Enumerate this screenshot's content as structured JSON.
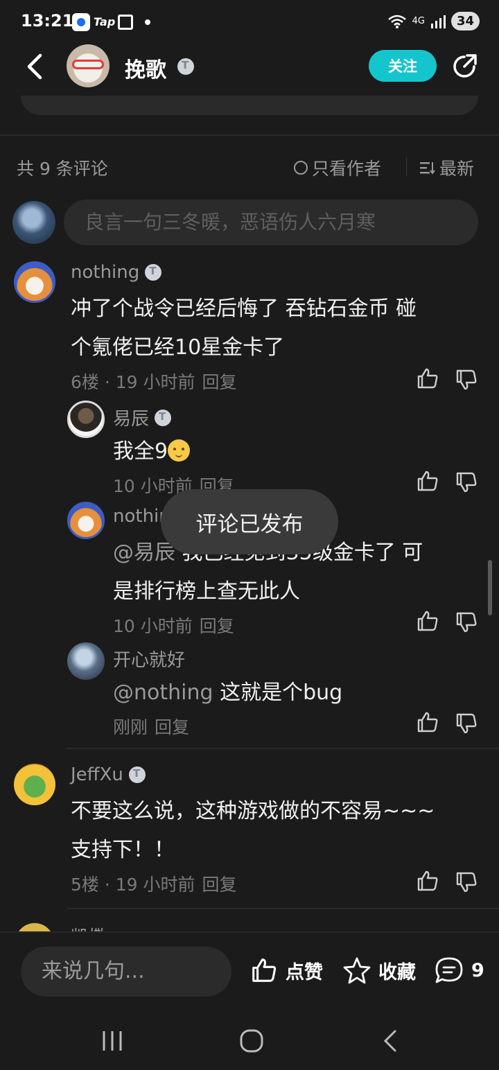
{
  "status_bar": {
    "time": "13:21",
    "app_label": "Tap",
    "network": "4G",
    "battery": "34"
  },
  "header": {
    "author_name": "挽歌",
    "follow_label": "关注"
  },
  "comments_header": {
    "count_label": "共 9 条评论",
    "author_only_label": "只看作者",
    "sort_label": "最新"
  },
  "input": {
    "placeholder": "良言一句三冬暖，恶语伤人六月寒"
  },
  "comments": [
    {
      "user": "nothing",
      "text_line1": "冲了个战令已经后悔了 吞钻石金币  碰",
      "text_line2": "个氪佬已经10星金卡了",
      "meta": "6楼 · 19 小时前",
      "reply_label": "回复",
      "replies": [
        {
          "user": "易辰",
          "text": "我全9",
          "meta": "10 小时前",
          "reply_label": "回复"
        },
        {
          "user": "nothing",
          "mention": "@易辰",
          "text_line1": "我已经见到35级金卡了  可",
          "text_line2": "是排行榜上查无此人",
          "meta": "10 小时前",
          "reply_label": "回复"
        },
        {
          "user": "开心就好",
          "mention": "@nothing",
          "text": "这就是个bug",
          "meta": "刚刚",
          "reply_label": "回复"
        }
      ]
    },
    {
      "user": "JeffXu",
      "text_line1": "不要这么说，这种游戏做的不容易~~~",
      "text_line2": "支持下！！",
      "meta": "5楼 · 19 小时前",
      "reply_label": "回复"
    },
    {
      "user": "凯撒"
    }
  ],
  "toast": {
    "text": "评论已发布"
  },
  "bottom_bar": {
    "reply_placeholder": "来说几句...",
    "like_label": "点赞",
    "favorite_label": "收藏",
    "comment_count": "9"
  }
}
